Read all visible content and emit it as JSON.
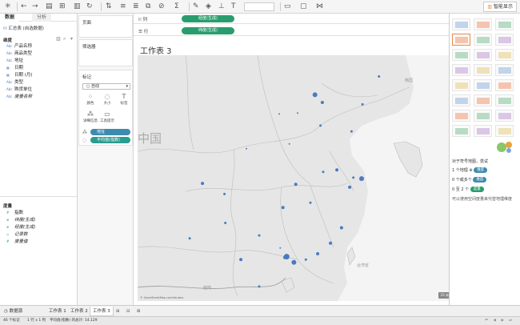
{
  "toolbar": {
    "smart_label": "智能显示"
  },
  "left": {
    "tab_data": "数据",
    "tab_analysis": "分析",
    "datasource": "汇总表 (自选数据)",
    "dimensions_header": "维度",
    "dimensions": [
      {
        "icon": "Abc",
        "label": "产品名称",
        "italic": false
      },
      {
        "icon": "Abc",
        "label": "商品类型",
        "italic": false
      },
      {
        "icon": "Abc",
        "label": "地址",
        "italic": false
      },
      {
        "icon": "▦",
        "label": "日期",
        "italic": false
      },
      {
        "icon": "▦",
        "label": "日期 (月)",
        "italic": false
      },
      {
        "icon": "Abc",
        "label": "类型",
        "italic": false
      },
      {
        "icon": "Abc",
        "label": "购货单位",
        "italic": false
      },
      {
        "icon": "Abc",
        "label": "度量名称",
        "italic": true
      }
    ],
    "measures_header": "度量",
    "measures": [
      {
        "icon": "#",
        "label": "指数",
        "italic": false
      },
      {
        "icon": "⊕",
        "label": "纬度(生成)",
        "italic": true
      },
      {
        "icon": "⊕",
        "label": "经度(生成)",
        "italic": true
      },
      {
        "icon": "=",
        "label": "记录数",
        "italic": true
      },
      {
        "icon": "#",
        "label": "度量值",
        "italic": true
      }
    ]
  },
  "mid": {
    "pages_title": "页面",
    "filters_title": "筛选器",
    "marks_title": "标记",
    "mark_type": "自动",
    "btn_color": "颜色",
    "btn_size": "大小",
    "btn_label": "标签",
    "btn_detail": "详细信息",
    "btn_tooltip": "工具提示",
    "pill_address": "地址",
    "pill_avg": "平均值(指数)"
  },
  "main": {
    "cols_label": "列",
    "rows_label": "行",
    "cols_pill": "经度(生成)",
    "rows_pill": "纬度(生成)",
    "sheet_title": "工作表 3",
    "map_label_china": "中国",
    "map_label_korea": "韩国",
    "map_label_taiwan": "台湾省",
    "map_label_vietnam": "越南",
    "map_credit": "© OpenStreetMap contributors",
    "null_badge": "23 未知",
    "dots": [
      {
        "lon": 116.4,
        "lat": 39.9,
        "r": 3
      },
      {
        "lon": 117.2,
        "lat": 39.1,
        "r": 2
      },
      {
        "lon": 123.4,
        "lat": 41.8,
        "r": 1.5
      },
      {
        "lon": 121.6,
        "lat": 38.9,
        "r": 1.5
      },
      {
        "lon": 126.6,
        "lat": 45.7,
        "r": 1.5
      },
      {
        "lon": 114.5,
        "lat": 38.0,
        "r": 1
      },
      {
        "lon": 112.5,
        "lat": 37.9,
        "r": 1
      },
      {
        "lon": 117.0,
        "lat": 36.7,
        "r": 1.5
      },
      {
        "lon": 120.4,
        "lat": 36.1,
        "r": 1.5
      },
      {
        "lon": 113.6,
        "lat": 34.8,
        "r": 1
      },
      {
        "lon": 108.9,
        "lat": 34.3,
        "r": 1
      },
      {
        "lon": 118.8,
        "lat": 32.1,
        "r": 2
      },
      {
        "lon": 120.6,
        "lat": 31.3,
        "r": 1.5
      },
      {
        "lon": 121.5,
        "lat": 31.2,
        "r": 3
      },
      {
        "lon": 120.2,
        "lat": 30.3,
        "r": 2
      },
      {
        "lon": 117.3,
        "lat": 31.9,
        "r": 1.5
      },
      {
        "lon": 114.3,
        "lat": 30.6,
        "r": 2
      },
      {
        "lon": 112.9,
        "lat": 28.2,
        "r": 2
      },
      {
        "lon": 115.9,
        "lat": 28.7,
        "r": 1.5
      },
      {
        "lon": 106.5,
        "lat": 29.6,
        "r": 1.5
      },
      {
        "lon": 104.1,
        "lat": 30.7,
        "r": 2
      },
      {
        "lon": 119.3,
        "lat": 26.1,
        "r": 2
      },
      {
        "lon": 118.1,
        "lat": 24.5,
        "r": 2
      },
      {
        "lon": 113.3,
        "lat": 23.1,
        "r": 3.5
      },
      {
        "lon": 114.1,
        "lat": 22.5,
        "r": 3
      },
      {
        "lon": 113.1,
        "lat": 23.0,
        "r": 2
      },
      {
        "lon": 110.3,
        "lat": 25.3,
        "r": 1.5
      },
      {
        "lon": 108.3,
        "lat": 22.8,
        "r": 2
      },
      {
        "lon": 110.3,
        "lat": 20.0,
        "r": 1.5
      },
      {
        "lon": 116.7,
        "lat": 23.4,
        "r": 2
      },
      {
        "lon": 115.4,
        "lat": 22.8,
        "r": 1.5
      },
      {
        "lon": 112.6,
        "lat": 24.0,
        "r": 1
      },
      {
        "lon": 102.7,
        "lat": 25.0,
        "r": 1.5
      },
      {
        "lon": 106.6,
        "lat": 26.6,
        "r": 1.5
      }
    ]
  },
  "panel": {
    "hint_title": "对于符号地图，尝试",
    "hint_line1_pre": "1 个地理",
    "hint_line1_tag": "维度",
    "hint_line2_pre": "0 个或多个",
    "hint_line2_tag": "维度",
    "hint_line3_pre": "0 至 2 个",
    "hint_line3_tag": "度量",
    "hint_note": "可以使用空间度量来代替地理维度"
  },
  "tabs": {
    "datasource": "数据源",
    "sheet1": "工作表 1",
    "sheet2": "工作表 2",
    "sheet3": "工作表 3"
  },
  "status": {
    "marks": "46 个标记",
    "rowscols": "1 行 x 1 列",
    "sum": "平均值(指数) 的总计: 14,129"
  },
  "colors": {
    "accent_green": "#2a9d6f",
    "dot": "#4a7bbf",
    "selected_border": "#e8894a"
  }
}
